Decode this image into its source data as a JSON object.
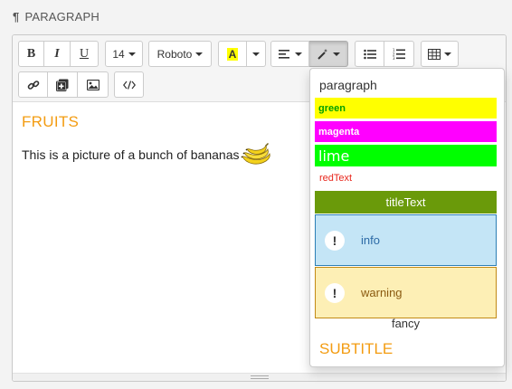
{
  "section": {
    "icon": "pilcrow-icon",
    "title": "PARAGRAPH"
  },
  "toolbar": {
    "bold": "B",
    "italic": "I",
    "underline": "U",
    "font_size": "14",
    "font_family": "Roboto",
    "highlight": "A",
    "colors": {
      "highlight_bg": "#ffff00"
    }
  },
  "content": {
    "heading": "FRUITS",
    "paragraph": "This is a picture of a bunch of bananas",
    "heading_color": "#f39c12"
  },
  "style_dropdown": {
    "options": [
      {
        "label": "paragraph"
      },
      {
        "label": "green",
        "bg": "#ffff00",
        "fg": "#00a000"
      },
      {
        "label": "magenta",
        "bg": "#ff00ff",
        "fg": "#ffffff"
      },
      {
        "label": "lime",
        "bg": "#00ff00",
        "fg": "#ffffff"
      },
      {
        "label": "redText",
        "fg": "#e8251b"
      },
      {
        "label": "titleText",
        "bg": "#6a9a0a",
        "fg": "#ffffff"
      },
      {
        "label": "info",
        "bg": "#c4e5f6",
        "fg": "#2c6aa6",
        "badge": "!"
      },
      {
        "label": "warning",
        "bg": "#fdefb5",
        "fg": "#8a5a10",
        "badge": "!"
      },
      {
        "label": "fancy"
      },
      {
        "label": "SUBTITLE",
        "fg": "#f39c12"
      }
    ]
  }
}
